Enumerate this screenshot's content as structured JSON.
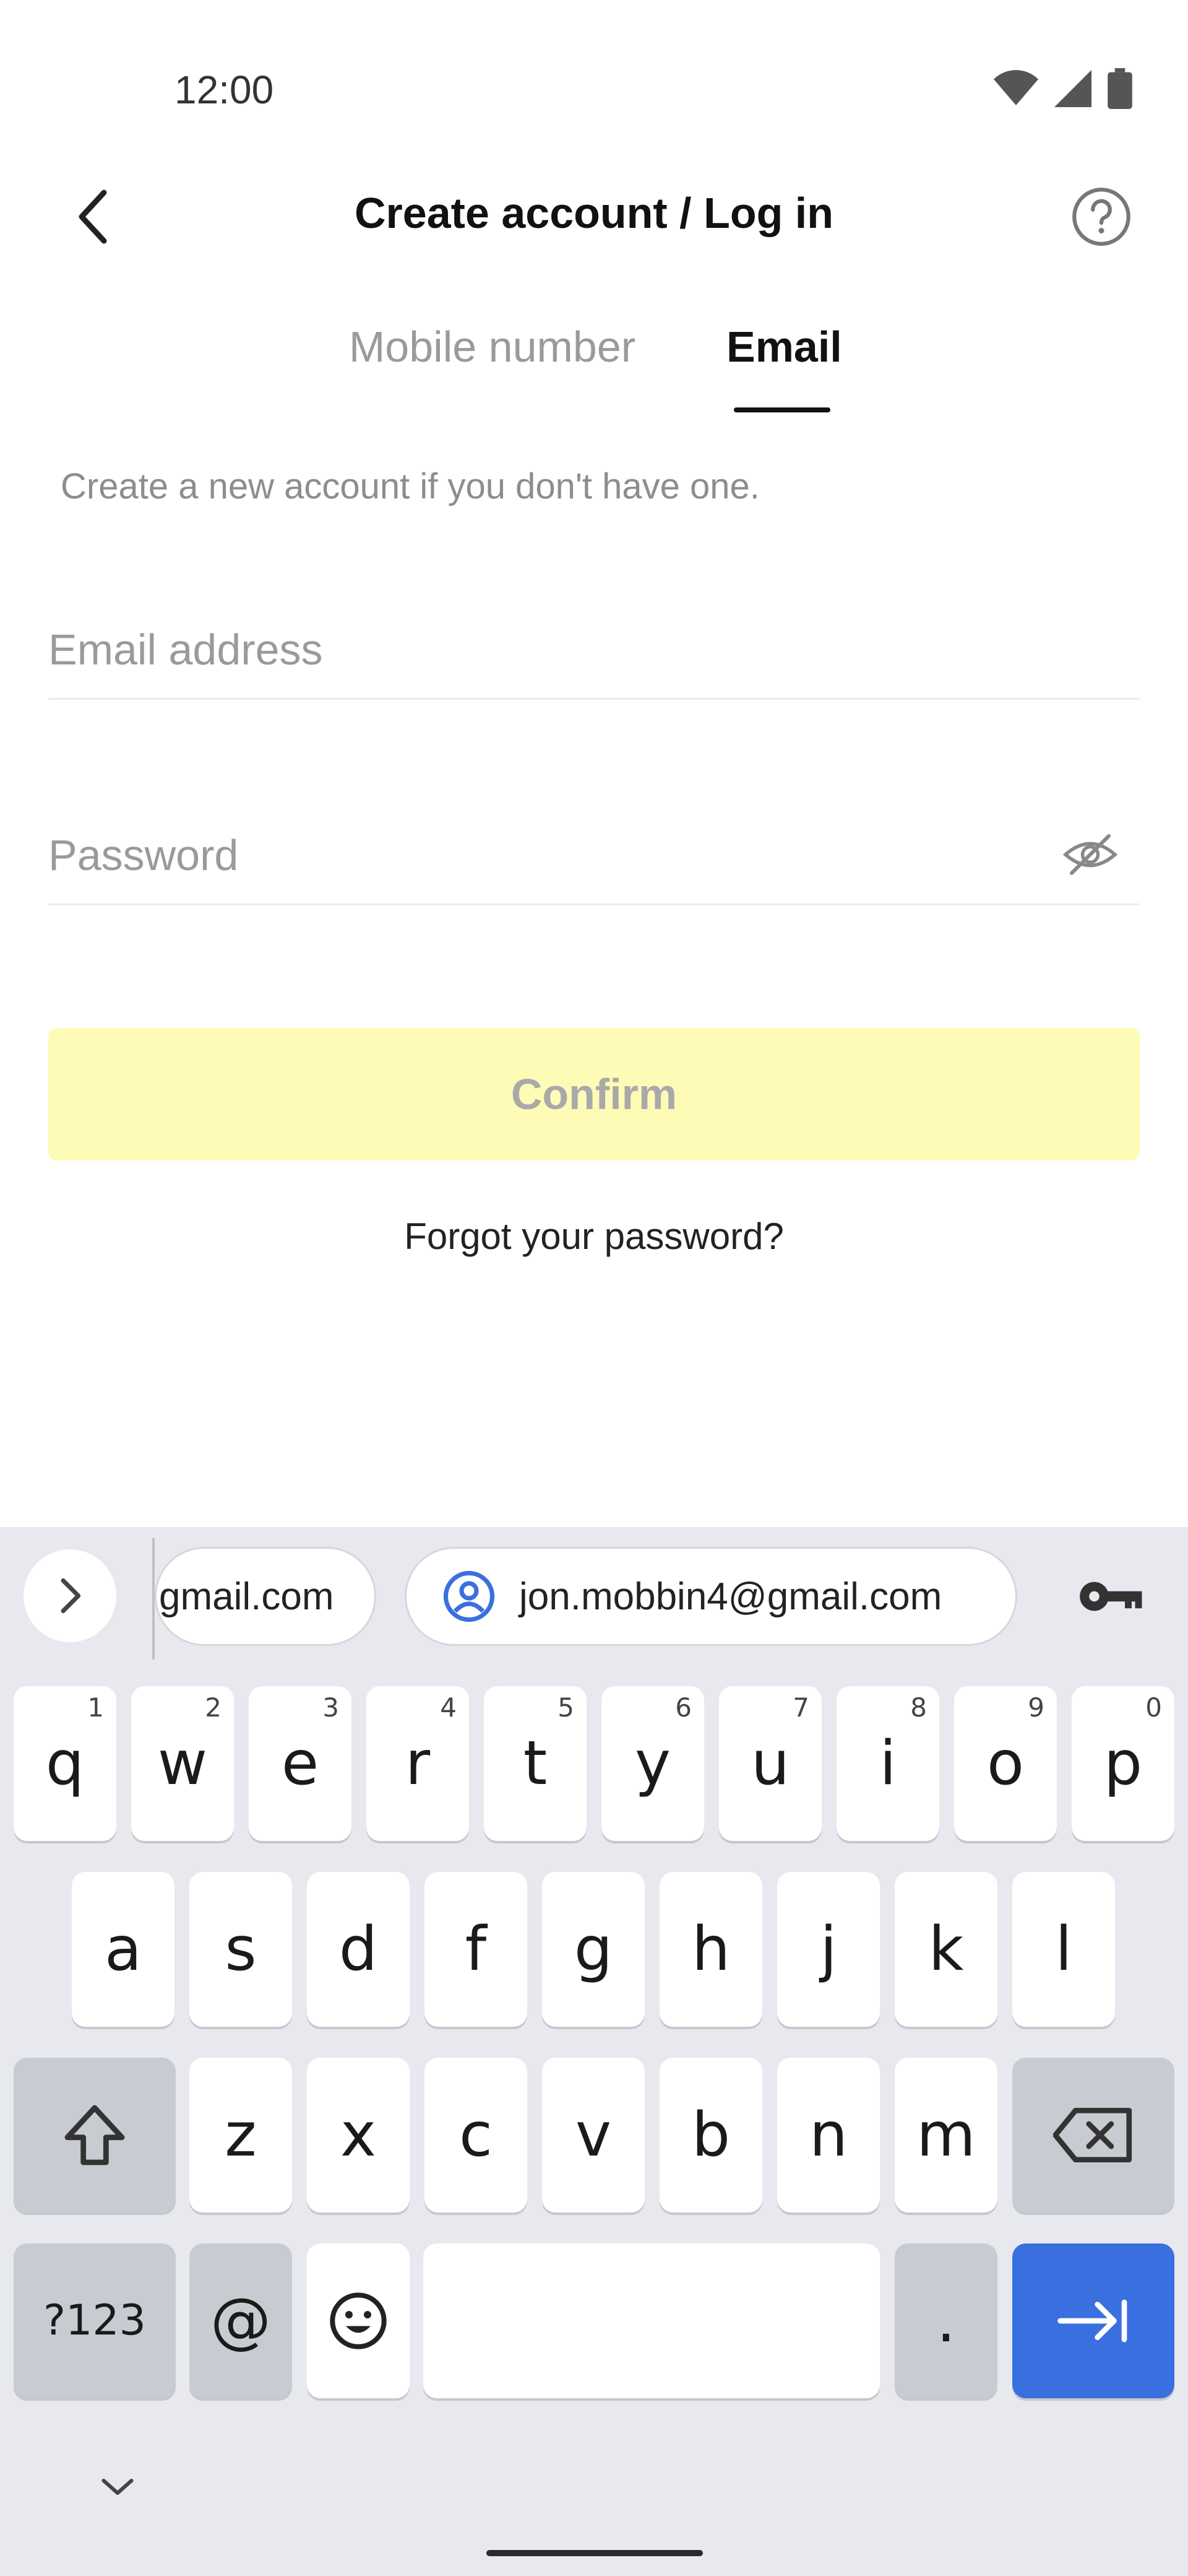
{
  "status_bar": {
    "time": "12:00"
  },
  "header": {
    "title": "Create account / Log in"
  },
  "tabs": [
    {
      "label": "Mobile number",
      "active": false
    },
    {
      "label": "Email",
      "active": true
    }
  ],
  "hint": "Create a new account if you don't have one.",
  "form": {
    "email_placeholder": "Email address",
    "email_value": "",
    "password_placeholder": "Password",
    "password_value": "",
    "confirm_label": "Confirm",
    "forgot_label": "Forgot your password?"
  },
  "colors": {
    "confirm_bg": "#fefbb6",
    "keyboard_bg": "#e8e9ee",
    "accent_key": "#3a6fe0"
  },
  "keyboard": {
    "suggestions": [
      "gmail.com",
      "jon.mobbin4@gmail.com"
    ],
    "row1": [
      {
        "k": "q",
        "n": "1"
      },
      {
        "k": "w",
        "n": "2"
      },
      {
        "k": "e",
        "n": "3"
      },
      {
        "k": "r",
        "n": "4"
      },
      {
        "k": "t",
        "n": "5"
      },
      {
        "k": "y",
        "n": "6"
      },
      {
        "k": "u",
        "n": "7"
      },
      {
        "k": "i",
        "n": "8"
      },
      {
        "k": "o",
        "n": "9"
      },
      {
        "k": "p",
        "n": "0"
      }
    ],
    "row2": [
      "a",
      "s",
      "d",
      "f",
      "g",
      "h",
      "j",
      "k",
      "l"
    ],
    "row3": [
      "z",
      "x",
      "c",
      "v",
      "b",
      "n",
      "m"
    ],
    "symbols_label": "?123",
    "at_label": "@",
    "period_label": ".",
    "icons": {
      "shift": "shift-icon",
      "backspace": "backspace-icon",
      "emoji": "emoji-icon",
      "next": "tab-next-icon",
      "password_key": "key-icon",
      "expand": "chevron-right-icon",
      "collapse": "chevron-down-icon"
    }
  }
}
